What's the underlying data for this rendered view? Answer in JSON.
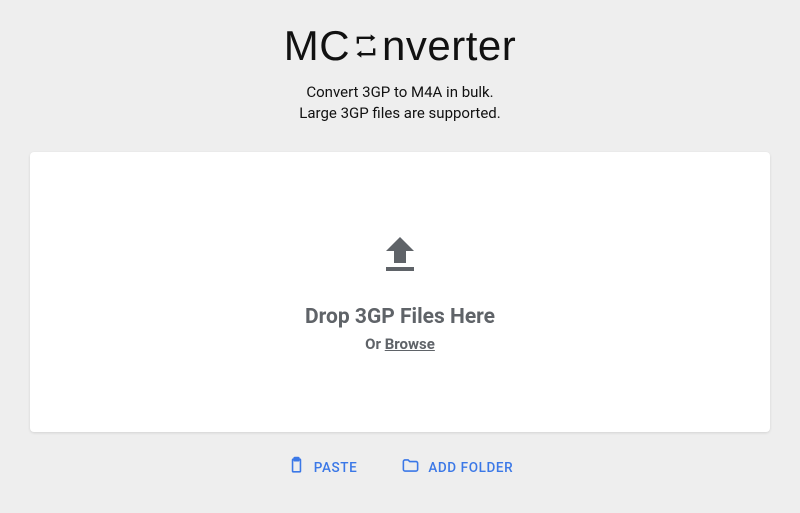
{
  "logo": {
    "part1": "MC",
    "part2": "nverter"
  },
  "subtitle": {
    "line1": "Convert 3GP to M4A in bulk.",
    "line2": "Large 3GP files are supported."
  },
  "dropzone": {
    "drop_text": "Drop 3GP Files Here",
    "or_text": "Or ",
    "browse_text": "Browse"
  },
  "actions": {
    "paste": "PASTE",
    "add_folder": "ADD FOLDER"
  }
}
